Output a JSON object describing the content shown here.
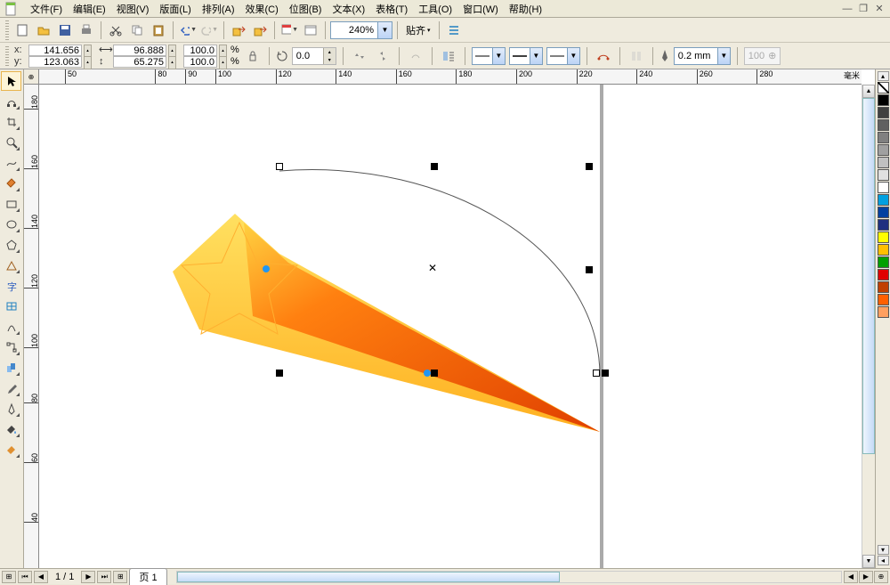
{
  "menu": {
    "file": "文件(F)",
    "edit": "编辑(E)",
    "view": "视图(V)",
    "layout": "版面(L)",
    "arrange": "排列(A)",
    "effects": "效果(C)",
    "bitmaps": "位图(B)",
    "text": "文本(X)",
    "table": "表格(T)",
    "tools": "工具(O)",
    "window": "窗口(W)",
    "help": "帮助(H)"
  },
  "toolbar": {
    "zoom": "240%",
    "snap": "贴齐"
  },
  "property": {
    "x_label": "x:",
    "y_label": "y:",
    "x_value": "141.656 mm",
    "y_value": "123.063 mm",
    "w_value": "96.888 mm",
    "h_value": "65.275 mm",
    "scale_x": "100.0",
    "scale_y": "100.0",
    "scale_unit": "%",
    "angle": "0.0",
    "outline_width": "0.2 mm",
    "disabled_num": "100"
  },
  "ruler": {
    "h_ticks": [
      50,
      80,
      90,
      100,
      120,
      140,
      160,
      180,
      200,
      220,
      240,
      260,
      280
    ],
    "h_end": "毫米",
    "v_ticks": [
      180,
      160,
      140,
      120,
      100,
      80,
      60,
      40
    ],
    "corner": "⊕"
  },
  "pagebar": {
    "counter": "1 / 1",
    "tab": "页 1"
  },
  "palette": {
    "colors": [
      "#000000",
      "#404040",
      "#606060",
      "#808080",
      "#a0a0a0",
      "#c0c0c0",
      "#e0e0e0",
      "#ffffff",
      "#00a0e0",
      "#0040a0",
      "#203080",
      "#ffff00",
      "#ffc000",
      "#00a000",
      "#e00000",
      "#c04000",
      "#ff6000",
      "#ffa060"
    ]
  }
}
